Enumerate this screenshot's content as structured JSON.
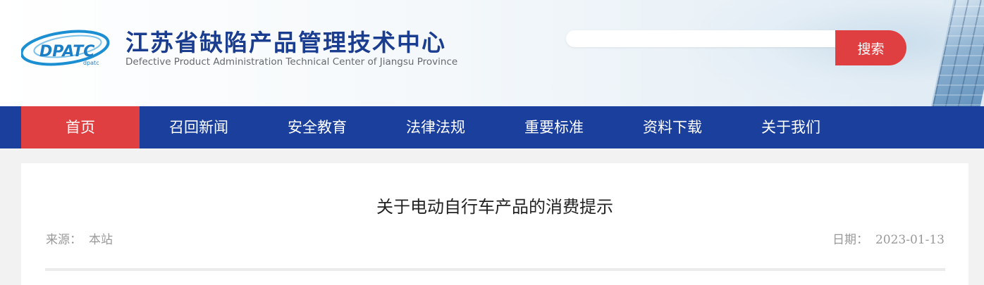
{
  "header": {
    "title": "江苏省缺陷产品管理技术中心",
    "subtitle": "Defective Product Administration Technical Center of Jiangsu Province",
    "logo_text": "DPATC",
    "logo_subtext": "dpatc"
  },
  "search": {
    "placeholder": "",
    "value": "",
    "button_label": "搜索"
  },
  "nav": {
    "items": [
      {
        "label": "首页",
        "active": true
      },
      {
        "label": "召回新闻",
        "active": false
      },
      {
        "label": "安全教育",
        "active": false
      },
      {
        "label": "法律法规",
        "active": false
      },
      {
        "label": "重要标准",
        "active": false
      },
      {
        "label": "资料下载",
        "active": false
      },
      {
        "label": "关于我们",
        "active": false
      }
    ]
  },
  "article": {
    "title": "关于电动自行车产品的消费提示",
    "source_label": "来源：",
    "source_value": "本站",
    "date_label": "日期：",
    "date_value": "2023-01-13"
  },
  "colors": {
    "brand_blue": "#1a3f9c",
    "accent_red": "#df3f40",
    "title_blue": "#1a3d8f",
    "meta_gray": "#999999"
  },
  "icons": {
    "logo": "dpatc-logo-icon"
  }
}
